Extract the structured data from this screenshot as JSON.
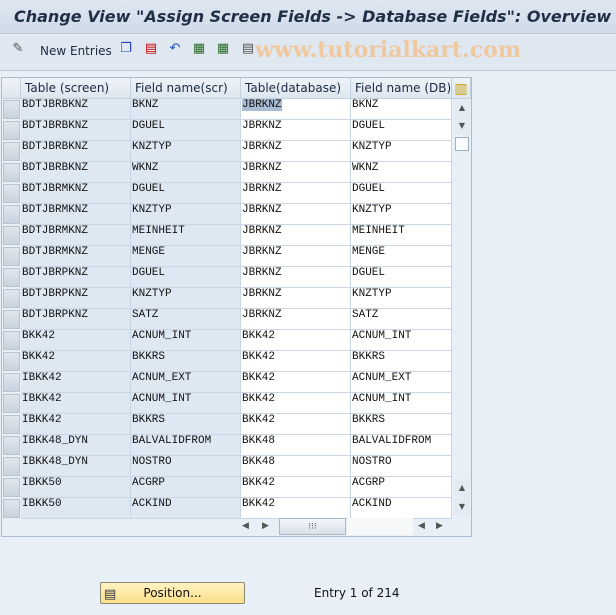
{
  "title": "Change View \"Assign Screen Fields -> Database Fields\": Overview",
  "toolbar": {
    "new_entries": "New Entries",
    "watermark": "www.tutorialkart.com",
    "icons": [
      "display-change-icon",
      "copy-icon",
      "delete-icon",
      "undo-icon",
      "select-all-icon",
      "select-block-icon",
      "deselect-all-icon"
    ]
  },
  "table": {
    "columns": [
      "Table (screen)",
      "Field name(scr)",
      "Table(database)",
      "Field name (DB)"
    ],
    "rows": [
      [
        "BDTJBRBKNZ",
        "BKNZ",
        "JBRKNZ",
        "BKNZ"
      ],
      [
        "BDTJBRBKNZ",
        "DGUEL",
        "JBRKNZ",
        "DGUEL"
      ],
      [
        "BDTJBRBKNZ",
        "KNZTYP",
        "JBRKNZ",
        "KNZTYP"
      ],
      [
        "BDTJBRBKNZ",
        "WKNZ",
        "JBRKNZ",
        "WKNZ"
      ],
      [
        "BDTJBRMKNZ",
        "DGUEL",
        "JBRKNZ",
        "DGUEL"
      ],
      [
        "BDTJBRMKNZ",
        "KNZTYP",
        "JBRKNZ",
        "KNZTYP"
      ],
      [
        "BDTJBRMKNZ",
        "MEINHEIT",
        "JBRKNZ",
        "MEINHEIT"
      ],
      [
        "BDTJBRMKNZ",
        "MENGE",
        "JBRKNZ",
        "MENGE"
      ],
      [
        "BDTJBRPKNZ",
        "DGUEL",
        "JBRKNZ",
        "DGUEL"
      ],
      [
        "BDTJBRPKNZ",
        "KNZTYP",
        "JBRKNZ",
        "KNZTYP"
      ],
      [
        "BDTJBRPKNZ",
        "SATZ",
        "JBRKNZ",
        "SATZ"
      ],
      [
        "BKK42",
        "ACNUM_INT",
        "BKK42",
        "ACNUM_INT"
      ],
      [
        "BKK42",
        "BKKRS",
        "BKK42",
        "BKKRS"
      ],
      [
        "IBKK42",
        "ACNUM_EXT",
        "BKK42",
        "ACNUM_EXT"
      ],
      [
        "IBKK42",
        "ACNUM_INT",
        "BKK42",
        "ACNUM_INT"
      ],
      [
        "IBKK42",
        "BKKRS",
        "BKK42",
        "BKKRS"
      ],
      [
        "IBKK48_DYN",
        "BALVALIDFROM",
        "BKK48",
        "BALVALIDFROM"
      ],
      [
        "IBKK48_DYN",
        "NOSTRO",
        "BKK48",
        "NOSTRO"
      ],
      [
        "IBKK50",
        "ACGRP",
        "BKK42",
        "ACGRP"
      ],
      [
        "IBKK50",
        "ACKIND",
        "BKK42",
        "ACKIND"
      ]
    ]
  },
  "position_button": "Position...",
  "entry_info": "Entry 1 of 214"
}
